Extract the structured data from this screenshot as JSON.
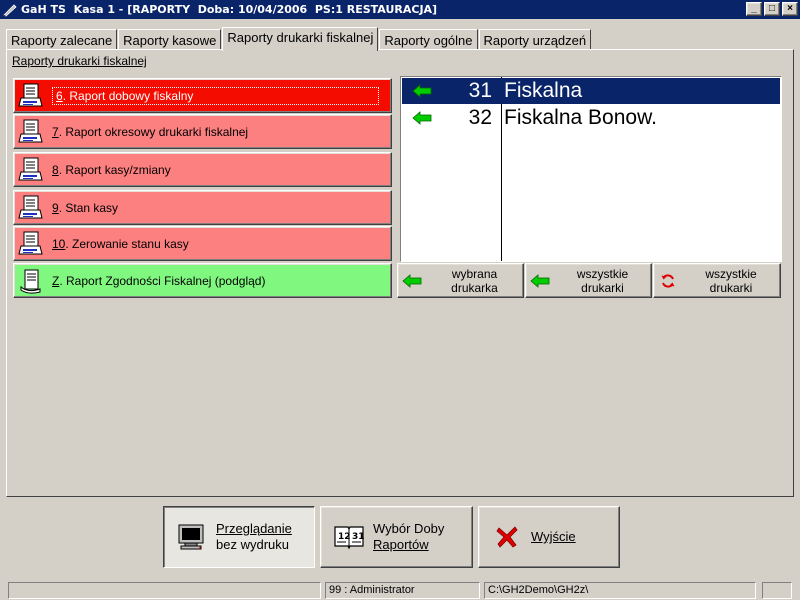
{
  "window": {
    "title": "GaH TS  Kasa 1 - [RAPORTY  Doba: 10/04/2006  PS:1 RESTAURACJA]",
    "minimize": "_",
    "maximize": "□",
    "close": "×"
  },
  "tabs": [
    {
      "label": "Raporty zalecane",
      "active": false
    },
    {
      "label": "Raporty kasowe",
      "active": false
    },
    {
      "label": "Raporty drukarki fiskalnej",
      "active": true
    },
    {
      "label": "Raporty ogólne",
      "active": false
    },
    {
      "label": "Raporty urządzeń",
      "active": false
    }
  ],
  "section_label": "Raporty drukarki fiskalnej",
  "reports": [
    {
      "num": "6",
      "text": ". Raport dobowy fiskalny",
      "state": "selected"
    },
    {
      "num": "7",
      "text": ". Raport okresowy drukarki fiskalnej",
      "state": "red"
    },
    {
      "num": "8",
      "text": ". Raport kasy/zmiany",
      "state": "red"
    },
    {
      "num": "9",
      "text": ". Stan kasy",
      "state": "red"
    },
    {
      "num": "10",
      "text": ". Zerowanie stanu kasy",
      "state": "red"
    },
    {
      "num": "Z",
      "text": ". Raport Zgodności Fiskalnej (podgląd)",
      "state": "green"
    }
  ],
  "printers": [
    {
      "num": "31",
      "name": "Fiskalna",
      "selected": true
    },
    {
      "num": "32",
      "name": "Fiskalna Bonow.",
      "selected": false
    }
  ],
  "print_buttons": [
    {
      "label": "wybrana\ndrukarka",
      "icon": "green-arrow-icon"
    },
    {
      "label": "wszystkie\ndrukarki",
      "icon": "green-arrow-icon"
    },
    {
      "label": "wszystkie\ndrukarki",
      "icon": "refresh-icon"
    }
  ],
  "bottom_buttons": {
    "preview": {
      "line1": "Przeglądanie",
      "line2": "bez wydruku"
    },
    "choose_day": {
      "line1": "Wybór Doby",
      "line2": "Raportów"
    },
    "exit": {
      "label": "Wyjście"
    }
  },
  "status": {
    "cell1": "",
    "user": "99 : Administrator",
    "path": "C:\\GH2Demo\\GH2z\\",
    "cell4": ""
  },
  "colors": {
    "titlebar": "#0a246a",
    "report_red": "#fc8080",
    "report_selected": "#f50c00",
    "report_green": "#80f880",
    "list_selected": "#0a246a",
    "arrow_green": "#00cc00",
    "refresh_red": "#e00000"
  }
}
